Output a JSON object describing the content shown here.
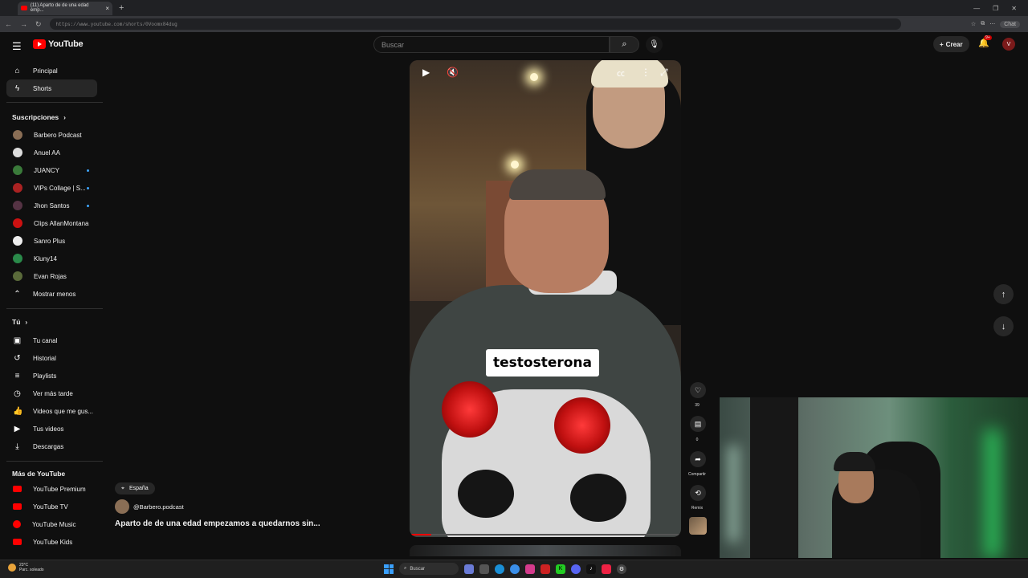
{
  "browser": {
    "tab_title": "(11) Aparto de de una edad emp...",
    "url": "https://www.youtube.com/shorts/0Voomx84dug",
    "chat_label": "Chat"
  },
  "header": {
    "logo_text": "YouTube",
    "search_placeholder": "Buscar",
    "create_label": "Crear",
    "notif_badge": "9+",
    "avatar_letter": "V"
  },
  "sidebar": {
    "main": [
      {
        "label": "Principal",
        "icon": "home-icon"
      },
      {
        "label": "Shorts",
        "icon": "shorts-icon"
      }
    ],
    "subs_header": "Suscripciones",
    "subs": [
      {
        "label": "Barbero Podcast",
        "color": "#8a6e55",
        "dot": false
      },
      {
        "label": "Anuel AA",
        "color": "#dddddd",
        "dot": false
      },
      {
        "label": "JUANCY",
        "color": "#3a7a3a",
        "dot": true
      },
      {
        "label": "VIPs Collage | S...",
        "color": "#aa2222",
        "dot": true
      },
      {
        "label": "Jhon Santos",
        "color": "#553344",
        "dot": true
      },
      {
        "label": "Clips AllanMontana",
        "color": "#cc1111",
        "dot": false
      },
      {
        "label": "Sanro Plus",
        "color": "#eeeeee",
        "dot": false
      },
      {
        "label": "Kluny14",
        "color": "#2a8a4a",
        "dot": false
      },
      {
        "label": "Evan Rojas",
        "color": "#5a6a3a",
        "dot": false
      }
    ],
    "show_less": "Mostrar menos",
    "you_header": "Tú",
    "you": [
      {
        "label": "Tu canal",
        "icon": "channel-icon"
      },
      {
        "label": "Historial",
        "icon": "history-icon"
      },
      {
        "label": "Playlists",
        "icon": "playlist-icon"
      },
      {
        "label": "Ver más tarde",
        "icon": "clock-icon"
      },
      {
        "label": "Videos que me gus...",
        "icon": "thumbs-up-icon"
      },
      {
        "label": "Tus videos",
        "icon": "video-icon"
      },
      {
        "label": "Descargas",
        "icon": "download-icon"
      }
    ],
    "more_header": "Más de YouTube",
    "more": [
      {
        "label": "YouTube Premium"
      },
      {
        "label": "YouTube TV"
      },
      {
        "label": "YouTube Music"
      },
      {
        "label": "YouTube Kids"
      }
    ]
  },
  "short": {
    "caption": "testosterona",
    "progress_fraction": 0.08,
    "location": "España",
    "channel": "@Barbero.podcast",
    "title": "Aparto de de una edad empezamos a quedarnos sin...",
    "likes": "39",
    "comments": "0",
    "share_label": "Compartir",
    "remix_label": "Remix"
  },
  "taskbar": {
    "temp": "23°C",
    "weather": "Parc. soleado",
    "search_label": "Buscar"
  }
}
